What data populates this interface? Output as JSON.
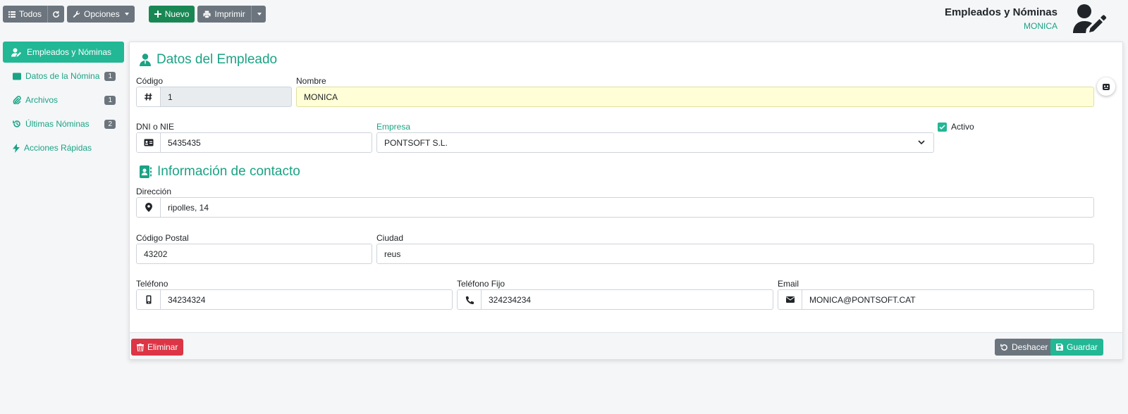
{
  "toolbar": {
    "todos_label": "Todos",
    "opciones_label": "Opciones",
    "nuevo_label": "Nuevo",
    "imprimir_label": "Imprimir"
  },
  "header": {
    "title": "Empleados y Nóminas",
    "user": "MONICA"
  },
  "sidebar": {
    "items": [
      {
        "label": "Empleados y Nóminas",
        "badge": ""
      },
      {
        "label": "Datos de la Nómina",
        "badge": "1"
      },
      {
        "label": "Archivos",
        "badge": "1"
      },
      {
        "label": "Últimas Nóminas",
        "badge": "2"
      },
      {
        "label": "Acciones Rápidas",
        "badge": ""
      }
    ]
  },
  "employee": {
    "section_title": "Datos del Empleado",
    "codigo_label": "Código",
    "codigo_value": "1",
    "nombre_label": "Nombre",
    "nombre_value": "MONICA",
    "dni_label": "DNI o NIE",
    "dni_value": "5435435",
    "empresa_label": "Empresa",
    "empresa_value": "PONTSOFT S.L.",
    "activo_label": "Activo",
    "activo_checked": true
  },
  "contact": {
    "section_title": "Información de contacto",
    "direccion_label": "Dirección",
    "direccion_value": "ripolles, 14",
    "cp_label": "Código Postal",
    "cp_value": "43202",
    "ciudad_label": "Ciudad",
    "ciudad_value": "reus",
    "telefono_label": "Teléfono",
    "telefono_value": "34234324",
    "fijo_label": "Teléfono Fijo",
    "fijo_value": "324234234",
    "email_label": "Email",
    "email_value": "MONICA@PONTSOFT.CAT"
  },
  "footer": {
    "eliminar_label": "Eliminar",
    "deshacer_label": "Deshacer",
    "guardar_label": "Guardar"
  },
  "colors": {
    "accent": "#22b795",
    "danger": "#dc3545",
    "secondary": "#6c757d",
    "success": "#198754"
  }
}
